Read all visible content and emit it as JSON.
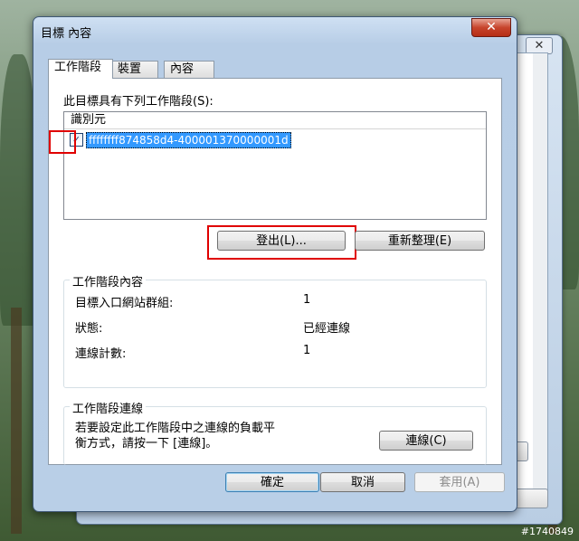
{
  "dialog": {
    "title": "目標 內容",
    "close_glyph": "✕"
  },
  "background_window": {
    "close_glyph": "✕"
  },
  "tabs": [
    {
      "label": "工作階段",
      "active": true
    },
    {
      "label": "裝置",
      "active": false
    },
    {
      "label": "內容",
      "active": false
    }
  ],
  "sessions": {
    "label": "此目標具有下列工作階段(S):",
    "column_header": "識別元",
    "items": [
      {
        "id": "ffffffff874858d4-400001370000001d",
        "checked": true
      }
    ],
    "logout_button": "登出(L)...",
    "refresh_button": "重新整理(E)"
  },
  "session_properties": {
    "title": "工作階段內容",
    "rows": [
      {
        "label": "目標入口網站群組:",
        "value": "1"
      },
      {
        "label": "狀態:",
        "value": "已經連線"
      },
      {
        "label": "連線計數:",
        "value": "1"
      }
    ]
  },
  "session_connections": {
    "title": "工作階段連線",
    "description_line1": "若要設定此工作階段中之連線的負載平",
    "description_line2": "衡方式，請按一下 [連線]。",
    "connections_button": "連線(C)"
  },
  "footer": {
    "ok": "確定",
    "cancel": "取消",
    "apply": "套用(A)"
  },
  "watermark": "#1740849",
  "colors": {
    "selection": "#3399ff",
    "highlight_box": "#e00000",
    "close_button": "#c7442c"
  }
}
